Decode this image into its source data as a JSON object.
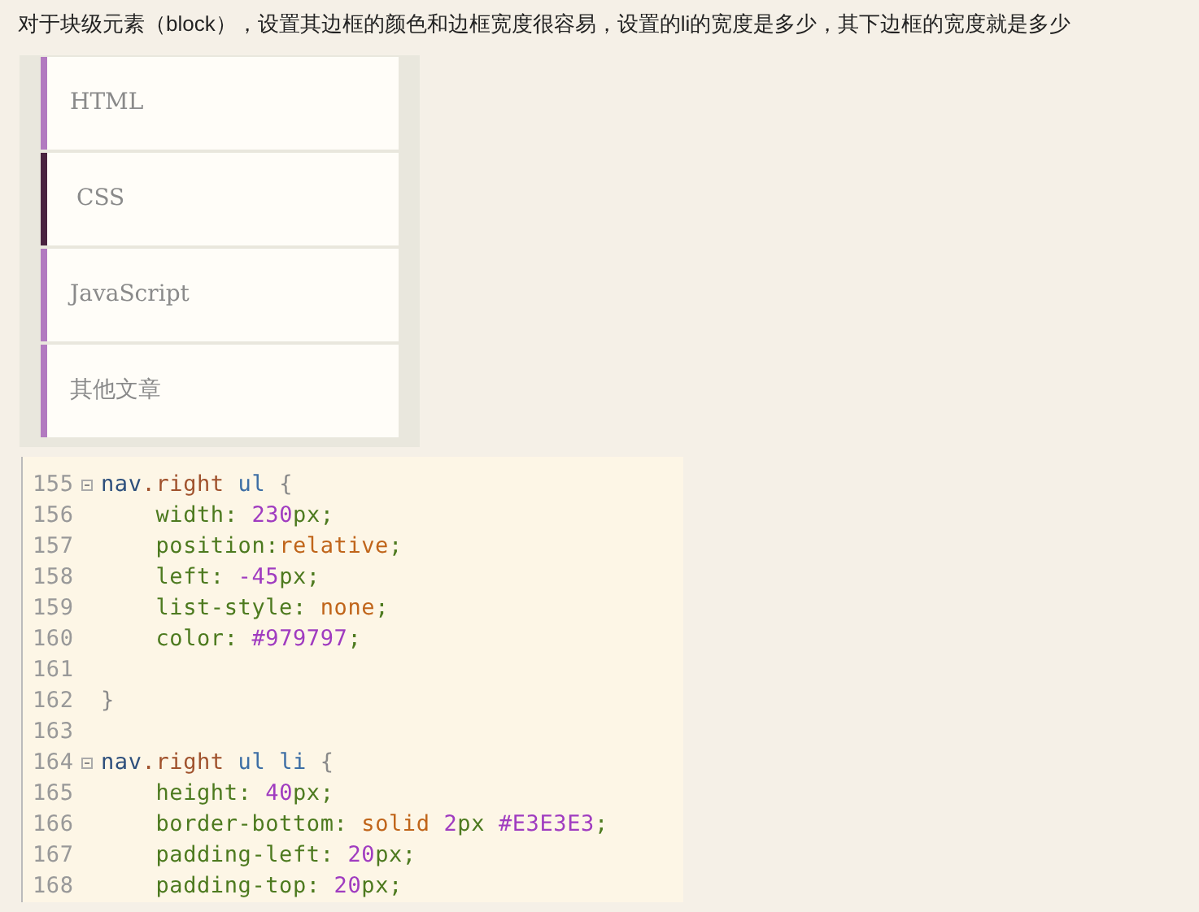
{
  "intro": "对于块级元素（block），设置其边框的颜色和边框宽度很容易，设置的li的宽度是多少，其下边框的宽度就是多少",
  "nav_items": [
    {
      "label": "HTML",
      "selected": false
    },
    {
      "label": "CSS",
      "selected": true
    },
    {
      "label": "JavaScript",
      "selected": false
    },
    {
      "label": "其他文章",
      "selected": false
    }
  ],
  "code_lines": [
    {
      "number": "155",
      "fold": true,
      "tokens": [
        {
          "kind": "tag",
          "text": "nav"
        },
        {
          "kind": "class",
          "text": ".right"
        },
        {
          "kind": "tag2",
          "text": " ul "
        },
        {
          "kind": "punct",
          "text": "{"
        }
      ]
    },
    {
      "number": "156",
      "fold": false,
      "tokens": [
        {
          "kind": "prop",
          "text": "    width: "
        },
        {
          "kind": "num",
          "text": "230"
        },
        {
          "kind": "prop",
          "text": "px;"
        }
      ]
    },
    {
      "number": "157",
      "fold": false,
      "tokens": [
        {
          "kind": "prop",
          "text": "    position:"
        },
        {
          "kind": "keyword",
          "text": "relative"
        },
        {
          "kind": "prop",
          "text": ";"
        }
      ]
    },
    {
      "number": "158",
      "fold": false,
      "tokens": [
        {
          "kind": "prop",
          "text": "    left: "
        },
        {
          "kind": "num",
          "text": "-45"
        },
        {
          "kind": "prop",
          "text": "px;"
        }
      ]
    },
    {
      "number": "159",
      "fold": false,
      "tokens": [
        {
          "kind": "prop",
          "text": "    list-style: "
        },
        {
          "kind": "keyword",
          "text": "none"
        },
        {
          "kind": "prop",
          "text": ";"
        }
      ]
    },
    {
      "number": "160",
      "fold": false,
      "tokens": [
        {
          "kind": "prop",
          "text": "    color: "
        },
        {
          "kind": "num",
          "text": "#979797"
        },
        {
          "kind": "prop",
          "text": ";"
        }
      ]
    },
    {
      "number": "161",
      "fold": false
    },
    {
      "number": "162",
      "fold": false,
      "tokens": [
        {
          "kind": "punct",
          "text": "}"
        }
      ]
    },
    {
      "number": "163",
      "fold": false
    },
    {
      "number": "164",
      "fold": true,
      "tokens": [
        {
          "kind": "tag",
          "text": "nav"
        },
        {
          "kind": "class",
          "text": ".right"
        },
        {
          "kind": "tag2",
          "text": " ul li "
        },
        {
          "kind": "punct",
          "text": "{"
        }
      ]
    },
    {
      "number": "165",
      "fold": false,
      "tokens": [
        {
          "kind": "prop",
          "text": "    height: "
        },
        {
          "kind": "num",
          "text": "40"
        },
        {
          "kind": "prop",
          "text": "px;"
        }
      ]
    },
    {
      "number": "166",
      "fold": false,
      "tokens": [
        {
          "kind": "prop",
          "text": "    border-bottom: "
        },
        {
          "kind": "keyword",
          "text": "solid "
        },
        {
          "kind": "num",
          "text": "2"
        },
        {
          "kind": "prop",
          "text": "px "
        },
        {
          "kind": "num",
          "text": "#E3E3E3"
        },
        {
          "kind": "prop",
          "text": ";"
        }
      ]
    },
    {
      "number": "167",
      "fold": false,
      "tokens": [
        {
          "kind": "prop",
          "text": "    padding-left: "
        },
        {
          "kind": "num",
          "text": "20"
        },
        {
          "kind": "prop",
          "text": "px;"
        }
      ]
    },
    {
      "number": "168",
      "fold": false,
      "tokens": [
        {
          "kind": "prop",
          "text": "    padding-top: "
        },
        {
          "kind": "num",
          "text": "20"
        },
        {
          "kind": "prop",
          "text": "px;"
        }
      ]
    }
  ]
}
